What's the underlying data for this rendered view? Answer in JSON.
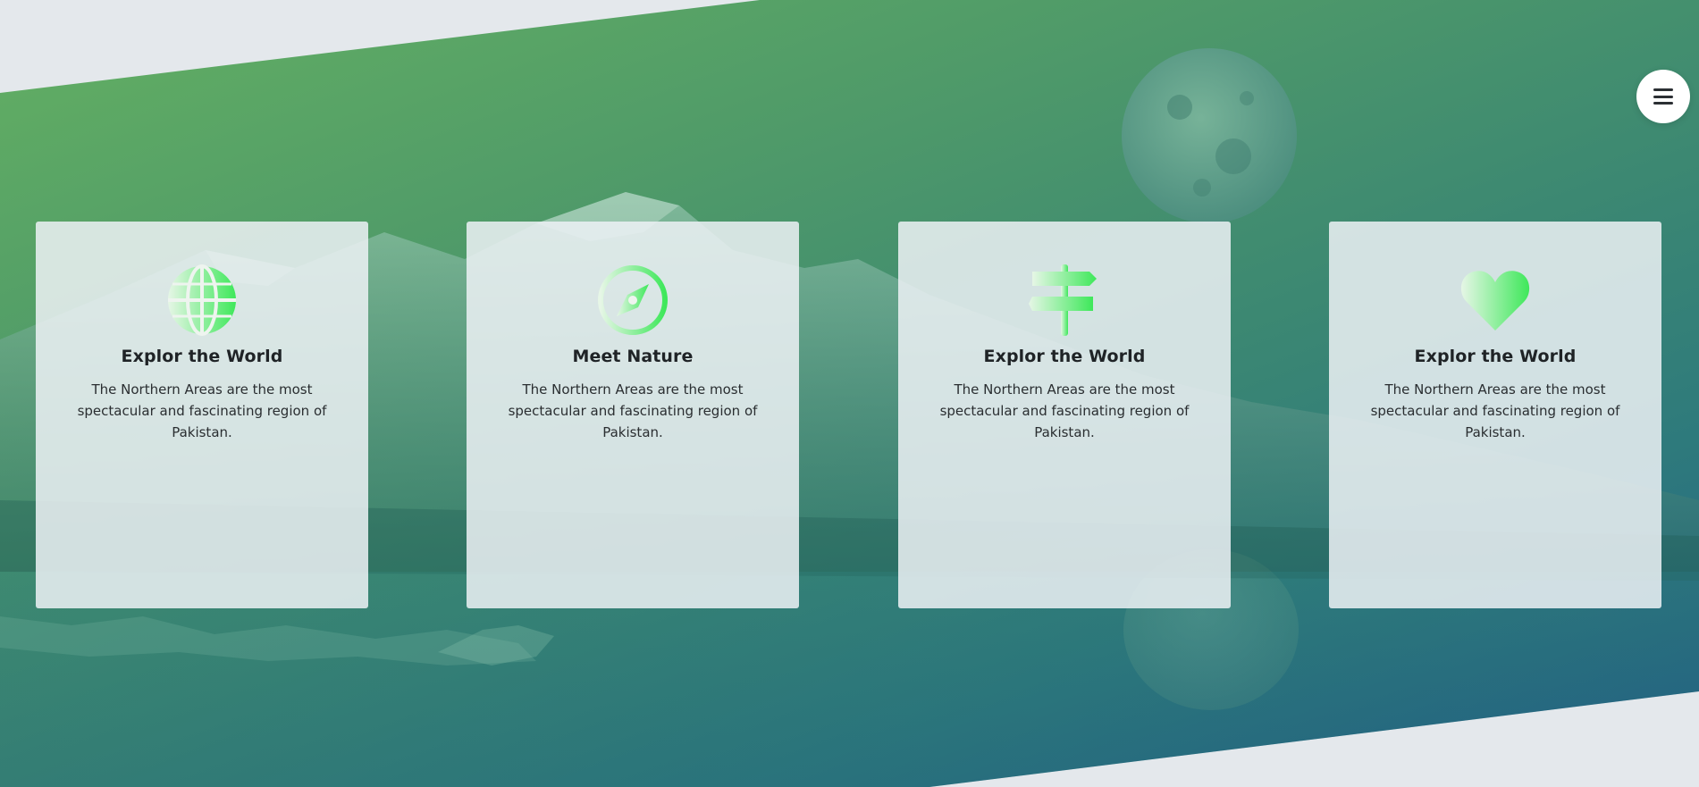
{
  "menu": {
    "icon": "hamburger-menu-icon",
    "background": "#ffffff"
  },
  "colors": {
    "gradient_start": "#64b062",
    "gradient_end": "#235e86",
    "icon_light": "#e6f6e6",
    "icon_accent": "#3ee85a",
    "page_background": "#e4e8ec"
  },
  "cards": [
    {
      "icon": "globe-icon",
      "title": "Explor the World",
      "description": "The Northern Areas are the most spectacular and fascinating region of Pakistan."
    },
    {
      "icon": "compass-icon",
      "title": "Meet Nature",
      "description": "The Northern Areas are the most spectacular and fascinating region of Pakistan."
    },
    {
      "icon": "signpost-icon",
      "title": "Explor the World",
      "description": "The Northern Areas are the most spectacular and fascinating region of Pakistan."
    },
    {
      "icon": "heart-icon",
      "title": "Explor the World",
      "description": "The Northern Areas are the most spectacular and fascinating region of Pakistan."
    }
  ]
}
